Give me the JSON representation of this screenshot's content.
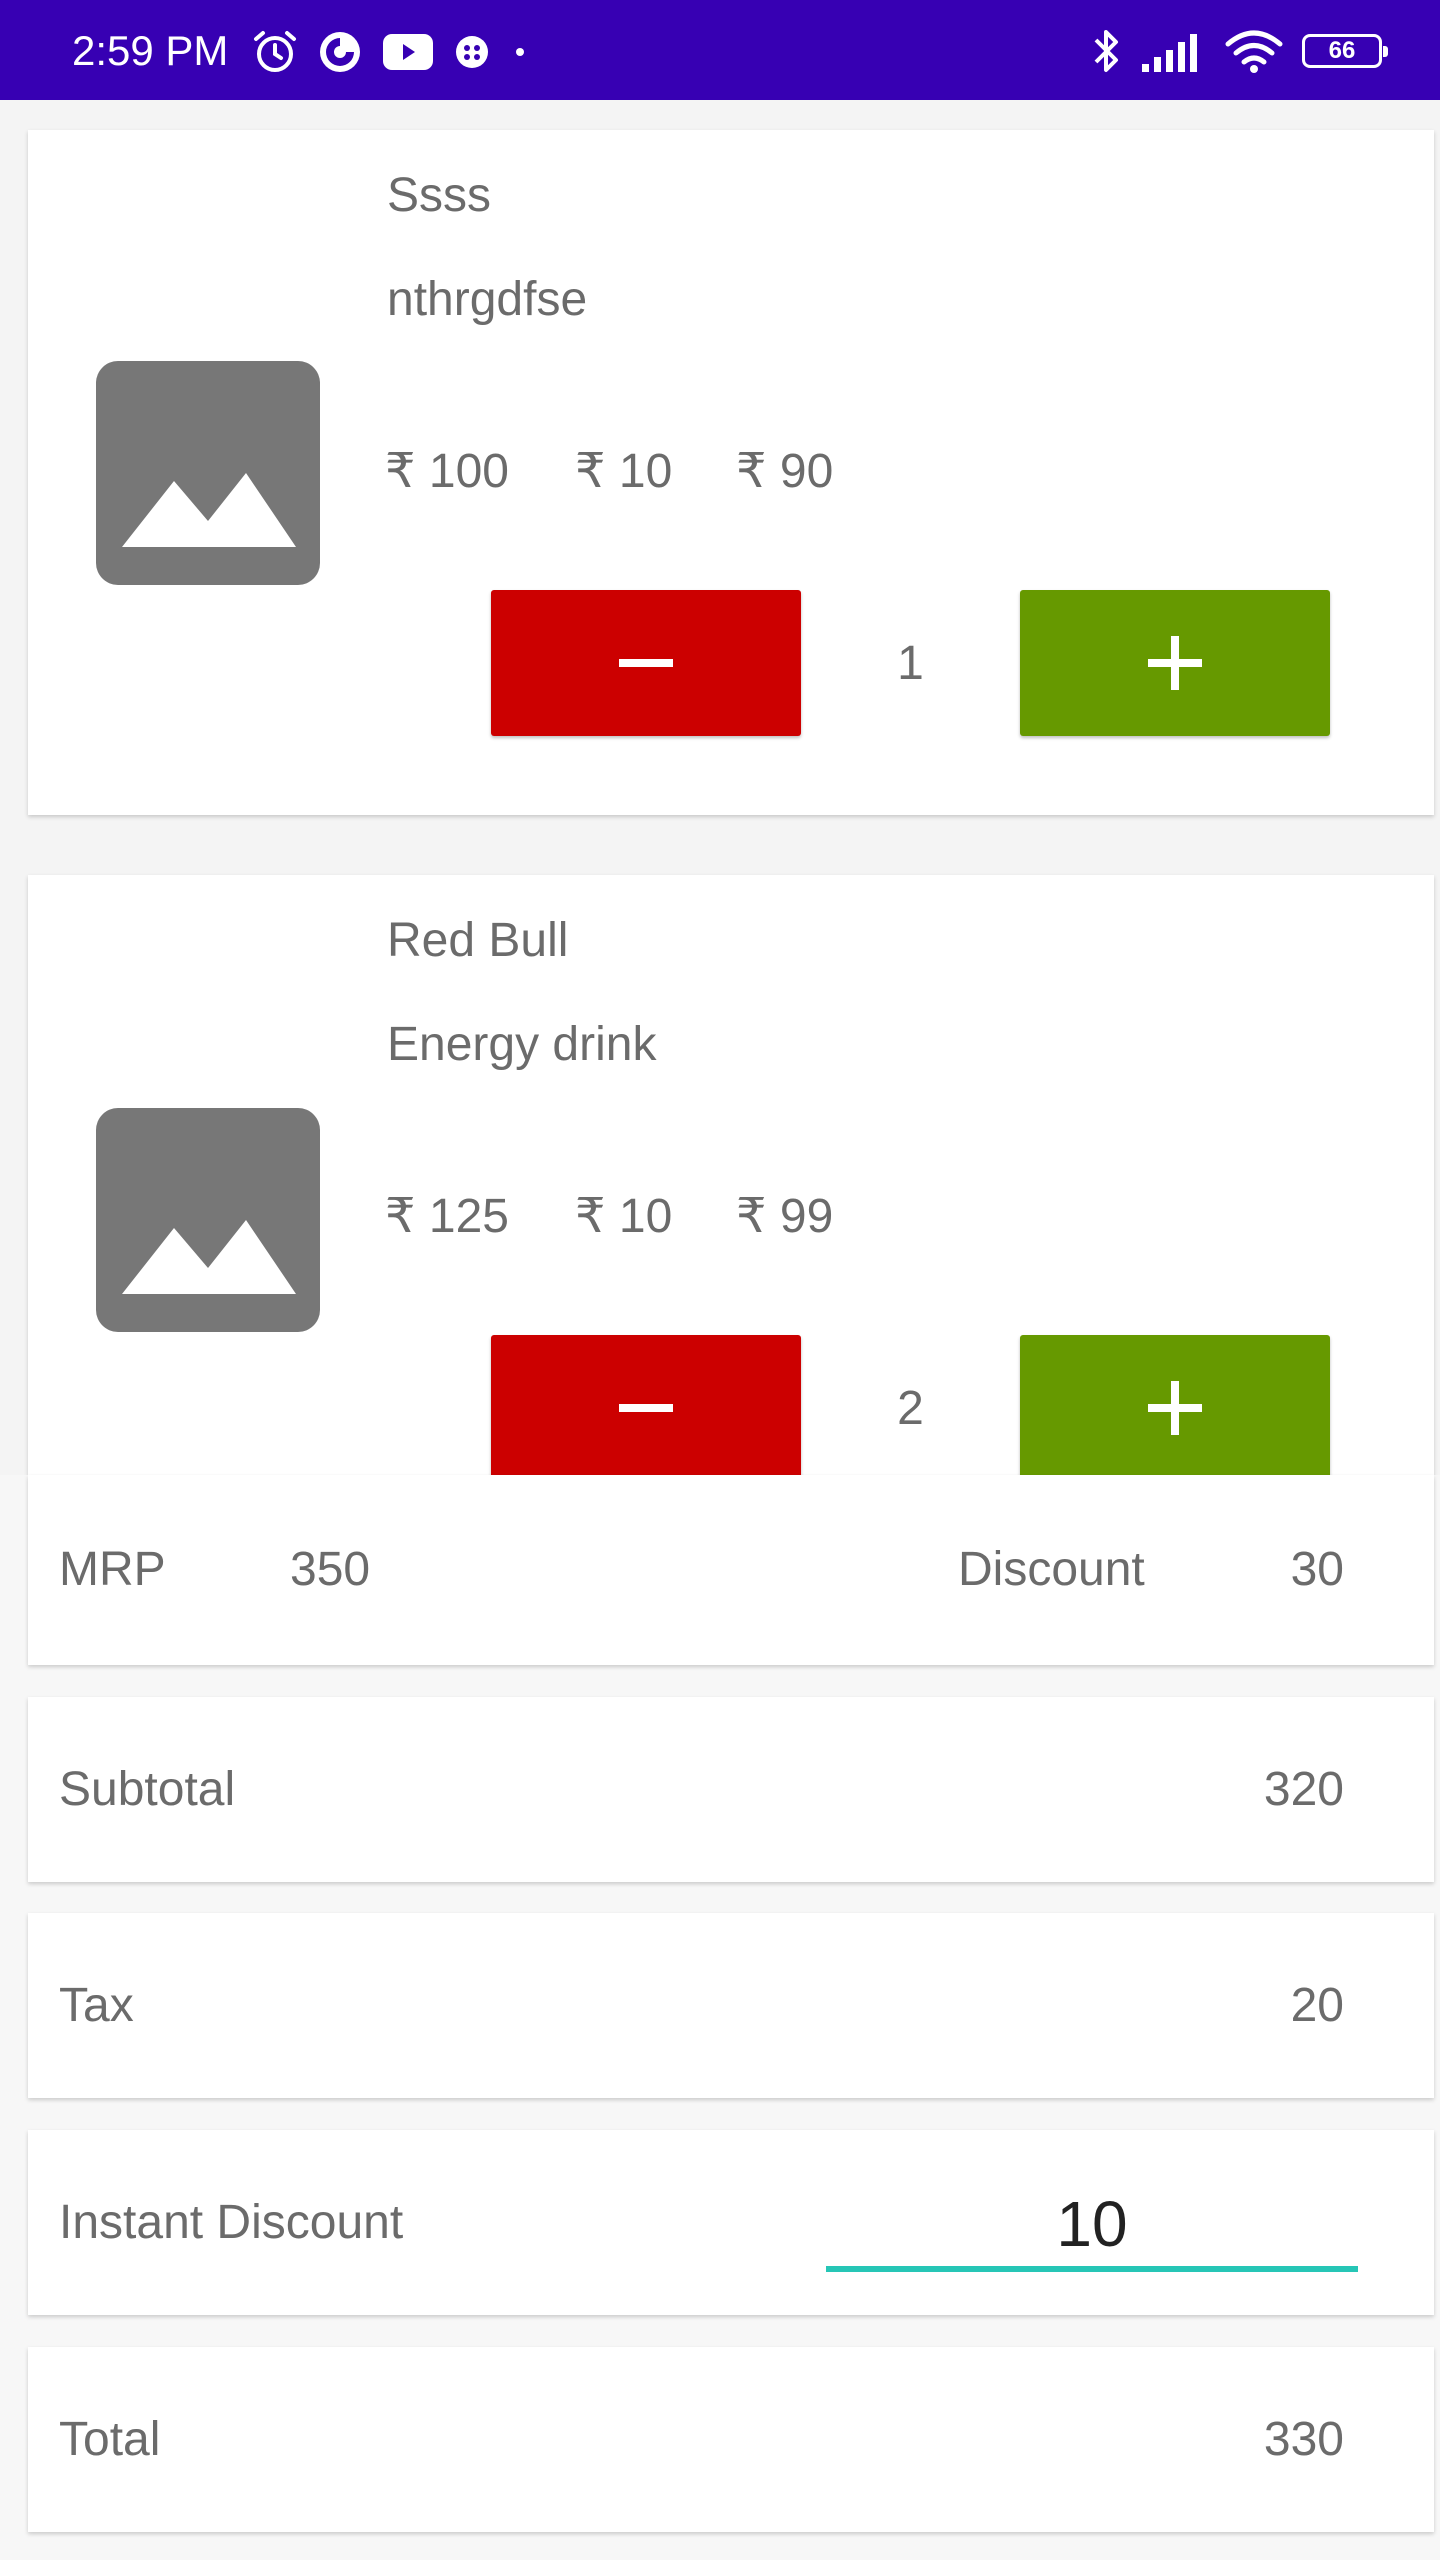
{
  "status_bar": {
    "time": "2:59 PM",
    "left_icons": [
      "alarm-icon",
      "pie-app-icon",
      "youtube-icon",
      "game-icon",
      "dot-icon"
    ],
    "right_icons": [
      "bluetooth-icon",
      "signal-icon",
      "wifi-icon",
      "battery-icon"
    ],
    "battery_level": "66",
    "colors": {
      "background": "#3700b3",
      "foreground": "#ffffff"
    }
  },
  "products": [
    {
      "title": "Ssss",
      "description": "nthrgdfse",
      "mrp": "₹ 100",
      "discount": "₹ 10",
      "final_price": "₹ 90",
      "quantity": "1",
      "image_icon": "image-placeholder-icon"
    },
    {
      "title": "Red Bull",
      "description": "Energy drink",
      "mrp": "₹ 125",
      "discount": "₹ 10",
      "final_price": "₹ 99",
      "quantity": "2",
      "image_icon": "image-placeholder-icon"
    }
  ],
  "buttons": {
    "minus_icon": "minus-icon",
    "plus_icon": "plus-icon",
    "minus_color": "#cc0000",
    "plus_color": "#669900"
  },
  "summary": {
    "mrp_label": "MRP",
    "mrp_value": "350",
    "discount_label": "Discount",
    "discount_value": "30",
    "subtotal_label": "Subtotal",
    "subtotal_value": "320",
    "tax_label": "Tax",
    "tax_value": "20",
    "instant_discount_label": "Instant Discount",
    "instant_discount_value": "10",
    "total_label": "Total",
    "total_value": "330"
  },
  "accent_color": "#26c6b6"
}
